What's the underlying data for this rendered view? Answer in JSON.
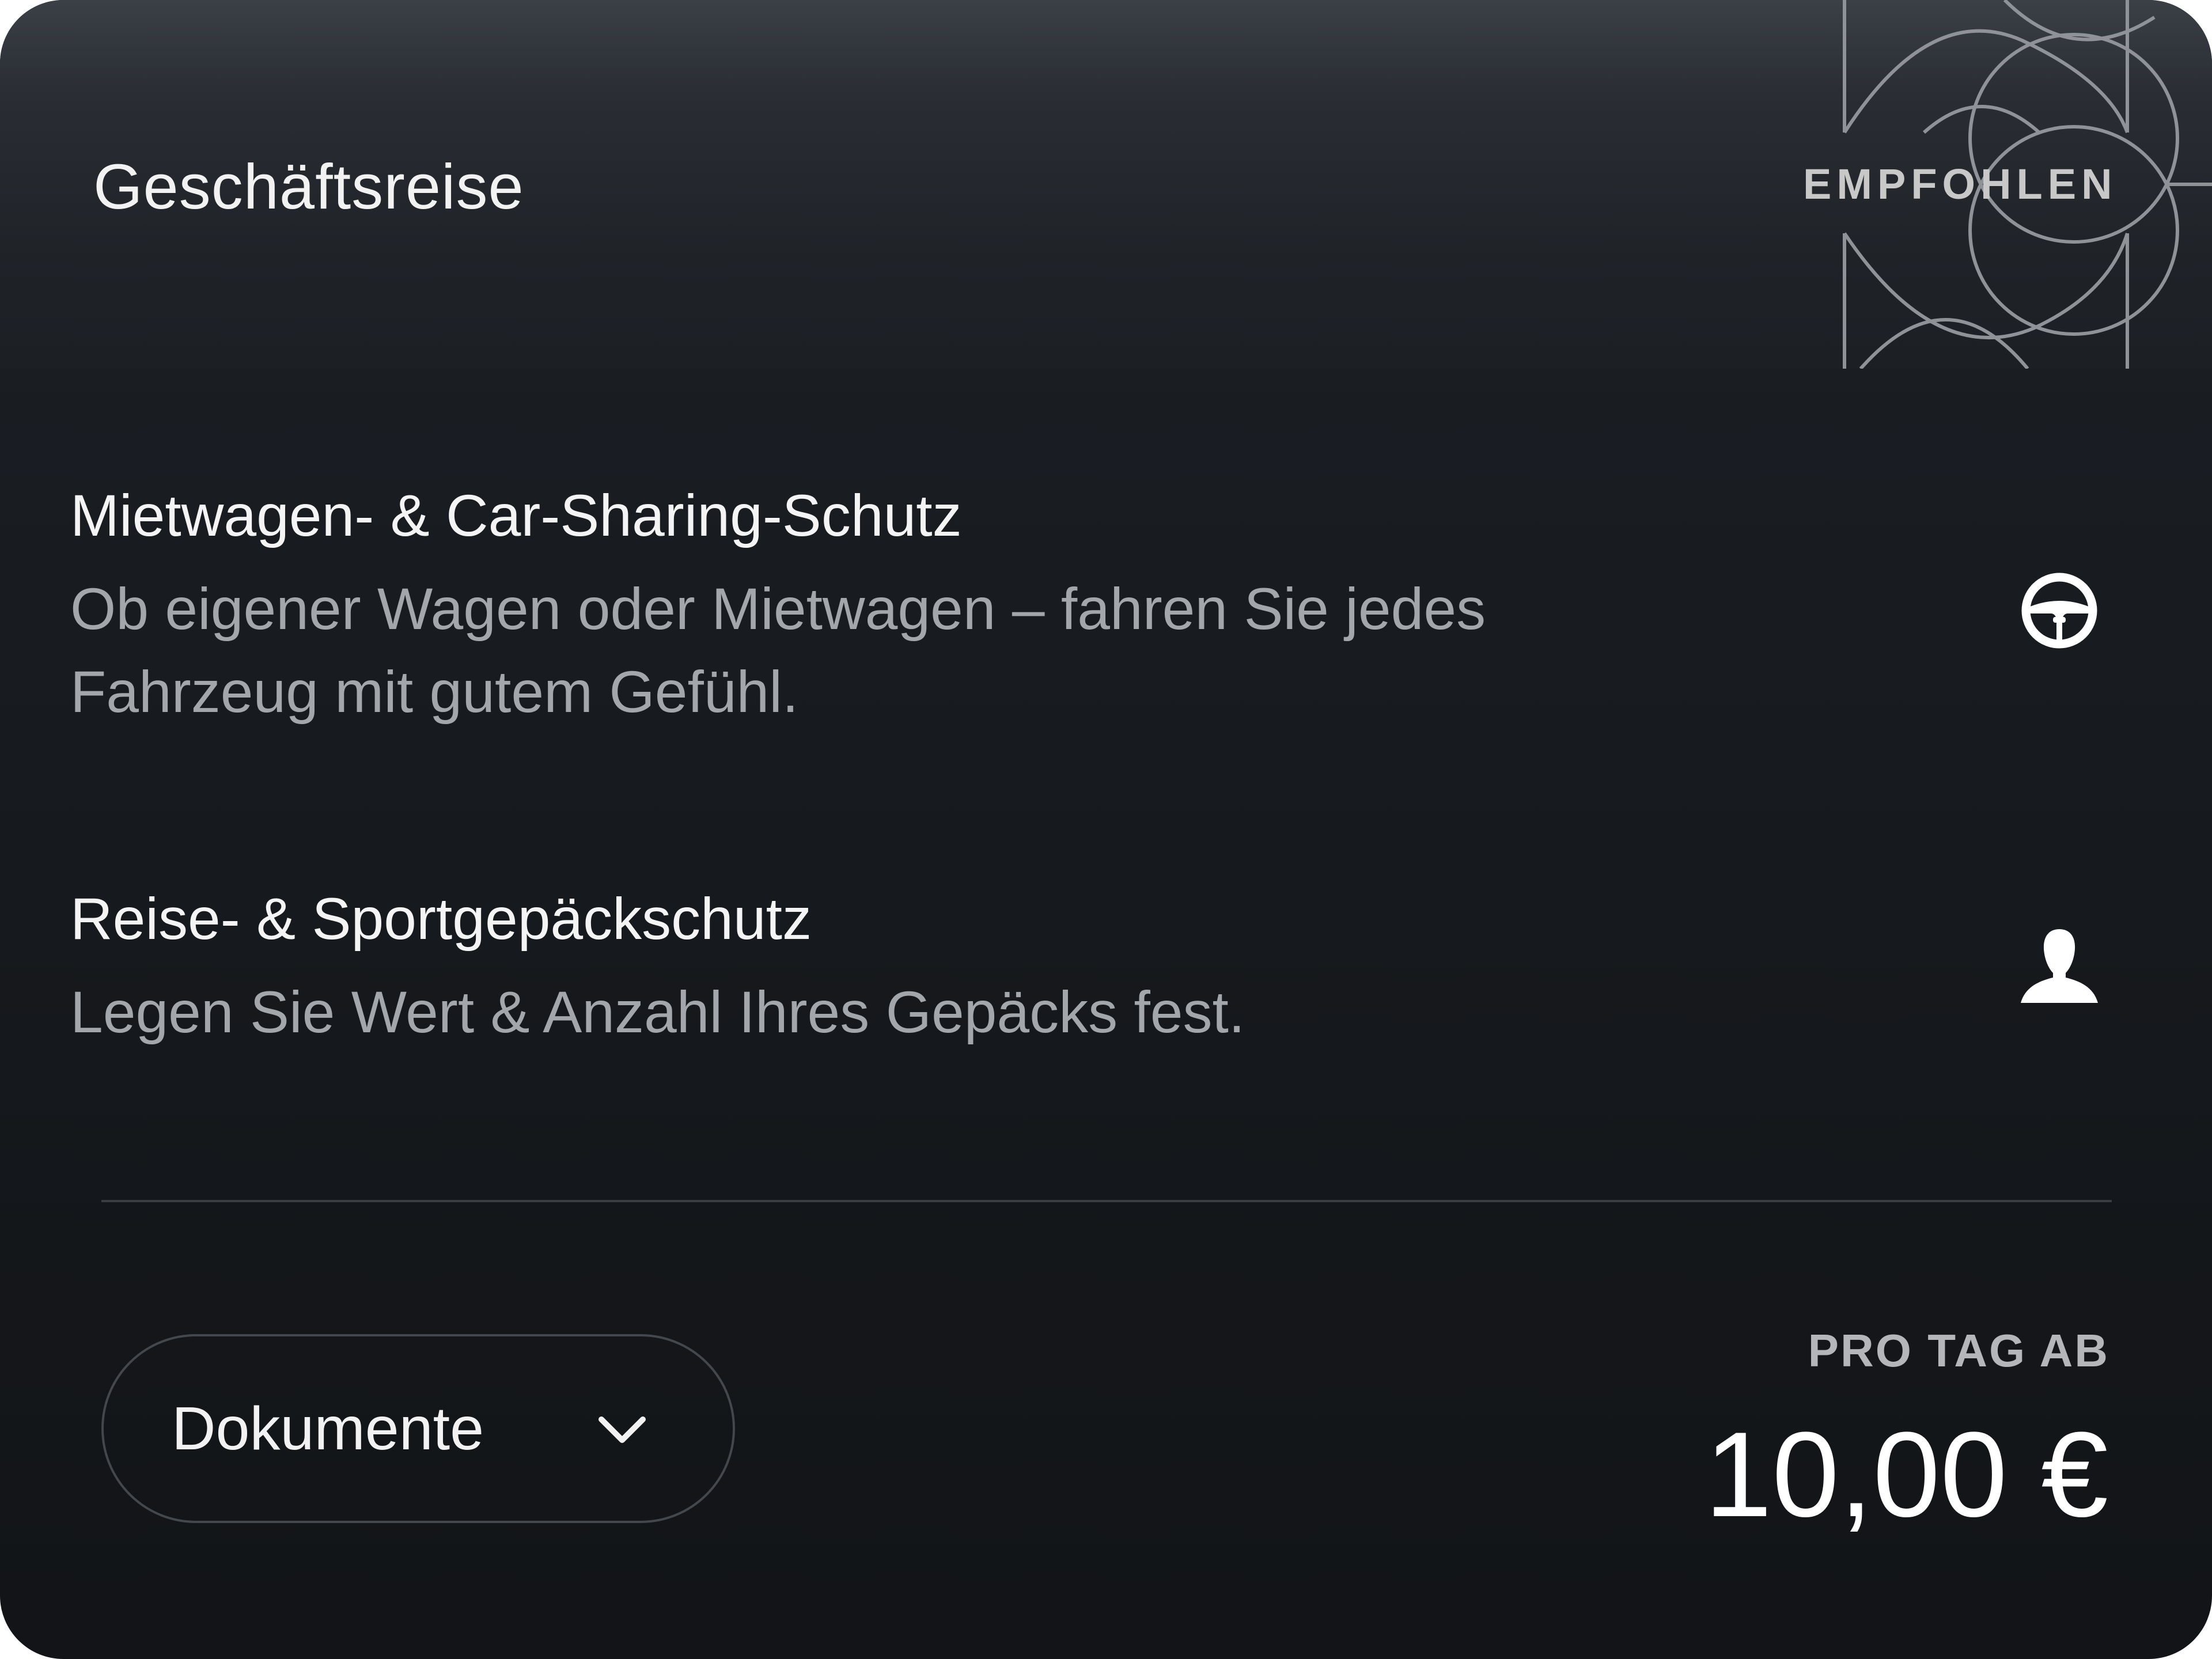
{
  "card": {
    "title": "Geschäftsreise",
    "badge": "EMPFOHLEN"
  },
  "features": [
    {
      "title": "Mietwagen- & Car-Sharing-Schutz",
      "description": "Ob eigener Wagen oder Mietwagen – fahren Sie jedes Fahrzeug mit gutem Gefühl.",
      "icon": "steering-wheel-icon"
    },
    {
      "title": "Reise- & Sportgepäckschutz",
      "description": "Legen Sie Wert & Anzahl Ihres Gepäcks fest.",
      "icon": "person-icon"
    }
  ],
  "footer": {
    "documents_label": "Dokumente",
    "documents_icon": "chevron-down-icon",
    "price_caption": "PRO TAG AB",
    "price": "10,00 €"
  },
  "colors": {
    "background": "#16191d",
    "header": "#2a2e34",
    "text_primary": "#f4f4f4",
    "text_secondary": "#a3a6aa",
    "badge": "#c8c8c8",
    "divider": "#3a3d42"
  }
}
